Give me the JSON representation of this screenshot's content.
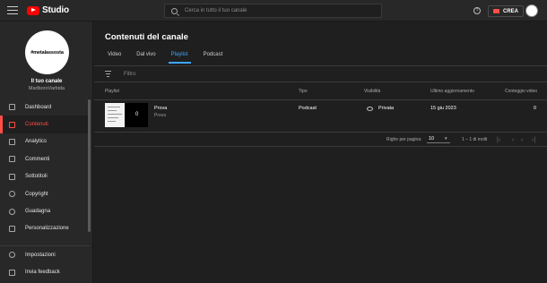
{
  "app": {
    "logo_text": "Studio",
    "brand_color": "#ff0000",
    "accent": "#3ea6ff",
    "active_nav_color": "#ff4e45"
  },
  "topbar": {
    "search_placeholder": "Cerca in tutto il tuo canale",
    "help_icon": "?",
    "create_label": "CREA"
  },
  "channel": {
    "avatar_text": "#metalassosta",
    "label": "Il tuo canale",
    "name": "MarlboroVarbida"
  },
  "sidebar": {
    "items": [
      {
        "label": "Dashboard",
        "icon": "dashboard-icon"
      },
      {
        "label": "Contenuti",
        "icon": "content-icon",
        "active": true
      },
      {
        "label": "Analytics",
        "icon": "analytics-icon"
      },
      {
        "label": "Commenti",
        "icon": "comments-icon"
      },
      {
        "label": "Sottotitoli",
        "icon": "subtitles-icon"
      },
      {
        "label": "Copyright",
        "icon": "copyright-icon"
      },
      {
        "label": "Guadagna",
        "icon": "monetization-icon"
      },
      {
        "label": "Personalizzazione",
        "icon": "customization-icon"
      }
    ],
    "bottom_items": [
      {
        "label": "Impostazioni",
        "icon": "gear-icon"
      },
      {
        "label": "Invia feedback",
        "icon": "feedback-icon"
      }
    ]
  },
  "main": {
    "title": "Contenuti del canale",
    "tabs": [
      {
        "label": "Video"
      },
      {
        "label": "Dal vivo"
      },
      {
        "label": "Playlist",
        "active": true
      },
      {
        "label": "Podcast"
      }
    ],
    "filter_label": "Filtro",
    "columns": [
      "Playlist",
      "Tipo",
      "Visibilità",
      "Ultimo aggiornamento",
      "Conteggio video"
    ],
    "rows": [
      {
        "title": "Prova",
        "subtitle": "Prova",
        "thumb_count": "0",
        "type": "Podcast",
        "visibility": "Privata",
        "updated": "15 giu 2023",
        "video_count": "0"
      }
    ],
    "pagination": {
      "rows_per_page_label": "Righe per pagina:",
      "rows_per_page": "10",
      "range": "1 – 1 di molti"
    }
  }
}
